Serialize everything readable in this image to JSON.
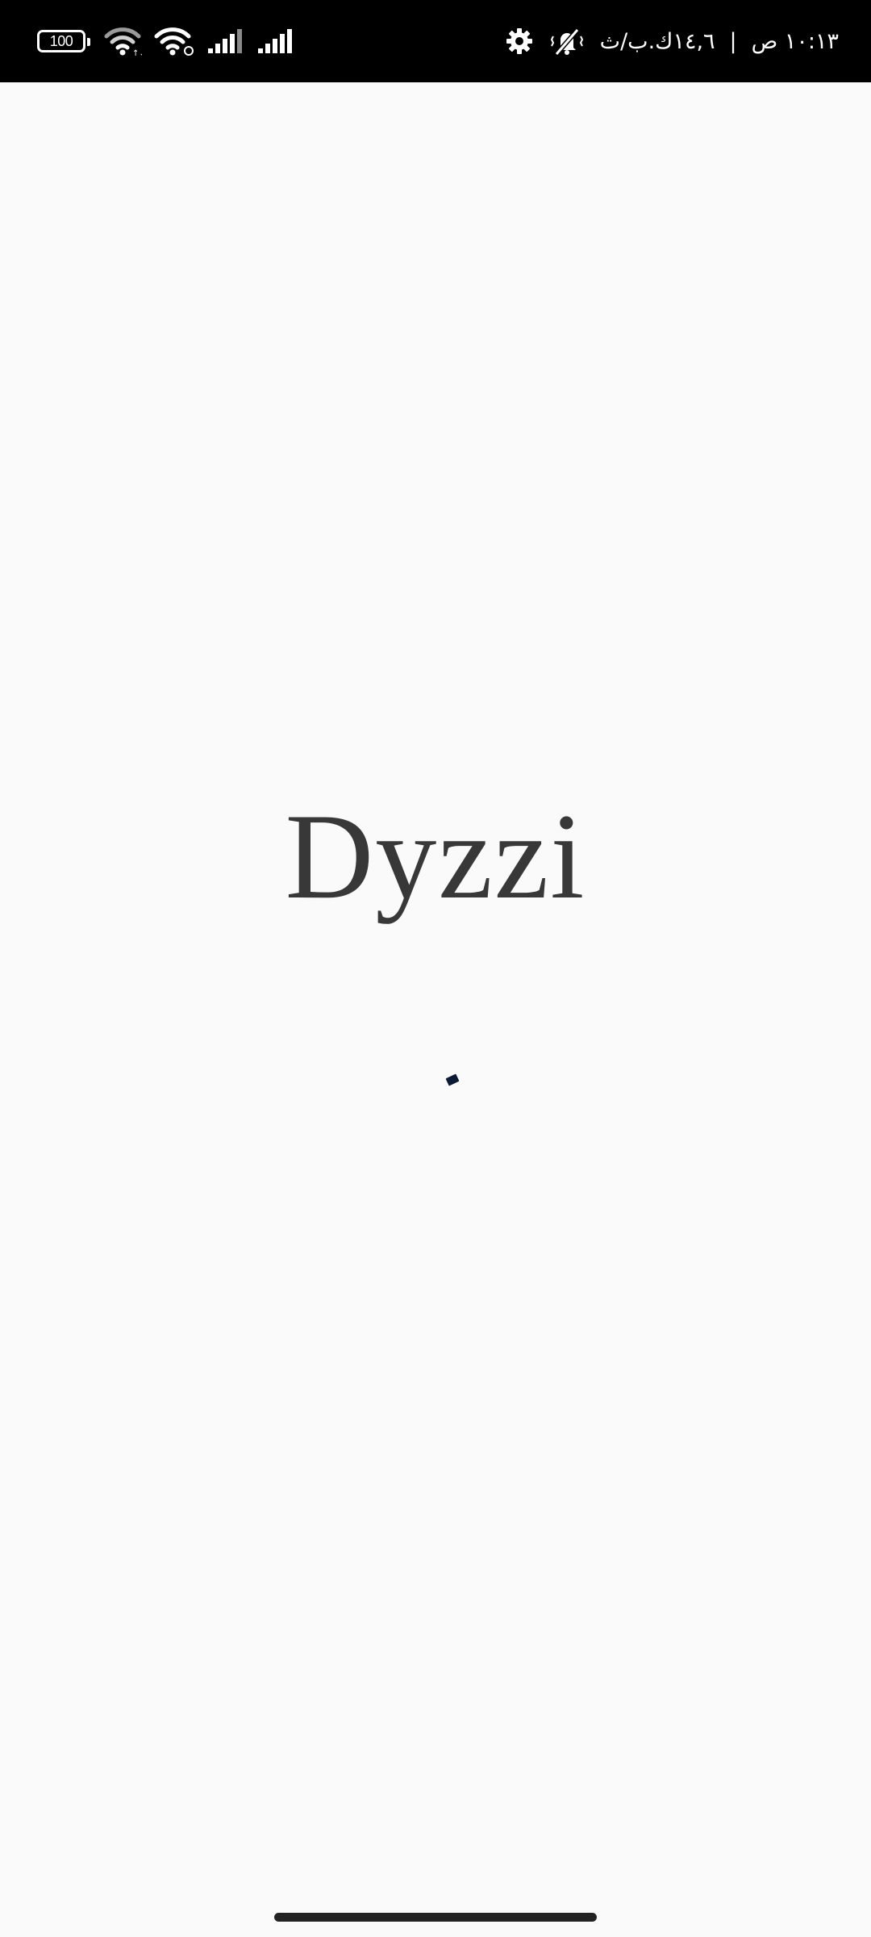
{
  "status_bar": {
    "battery_level": "100",
    "icons": [
      "battery-icon",
      "wifi-icon",
      "wifi-icon",
      "signal-icon",
      "signal-icon",
      "settings-icon",
      "mute-vibrate-icon"
    ],
    "network_speed": "١٤,٦ك.ب/ث",
    "separator": "|",
    "time": "١٠:١٣ ص"
  },
  "splash": {
    "app_name": "Dyzzi"
  },
  "colors": {
    "background": "#fafafa",
    "status_bar": "#000000",
    "logo_text": "#383838",
    "loader": "#0d1a36"
  }
}
